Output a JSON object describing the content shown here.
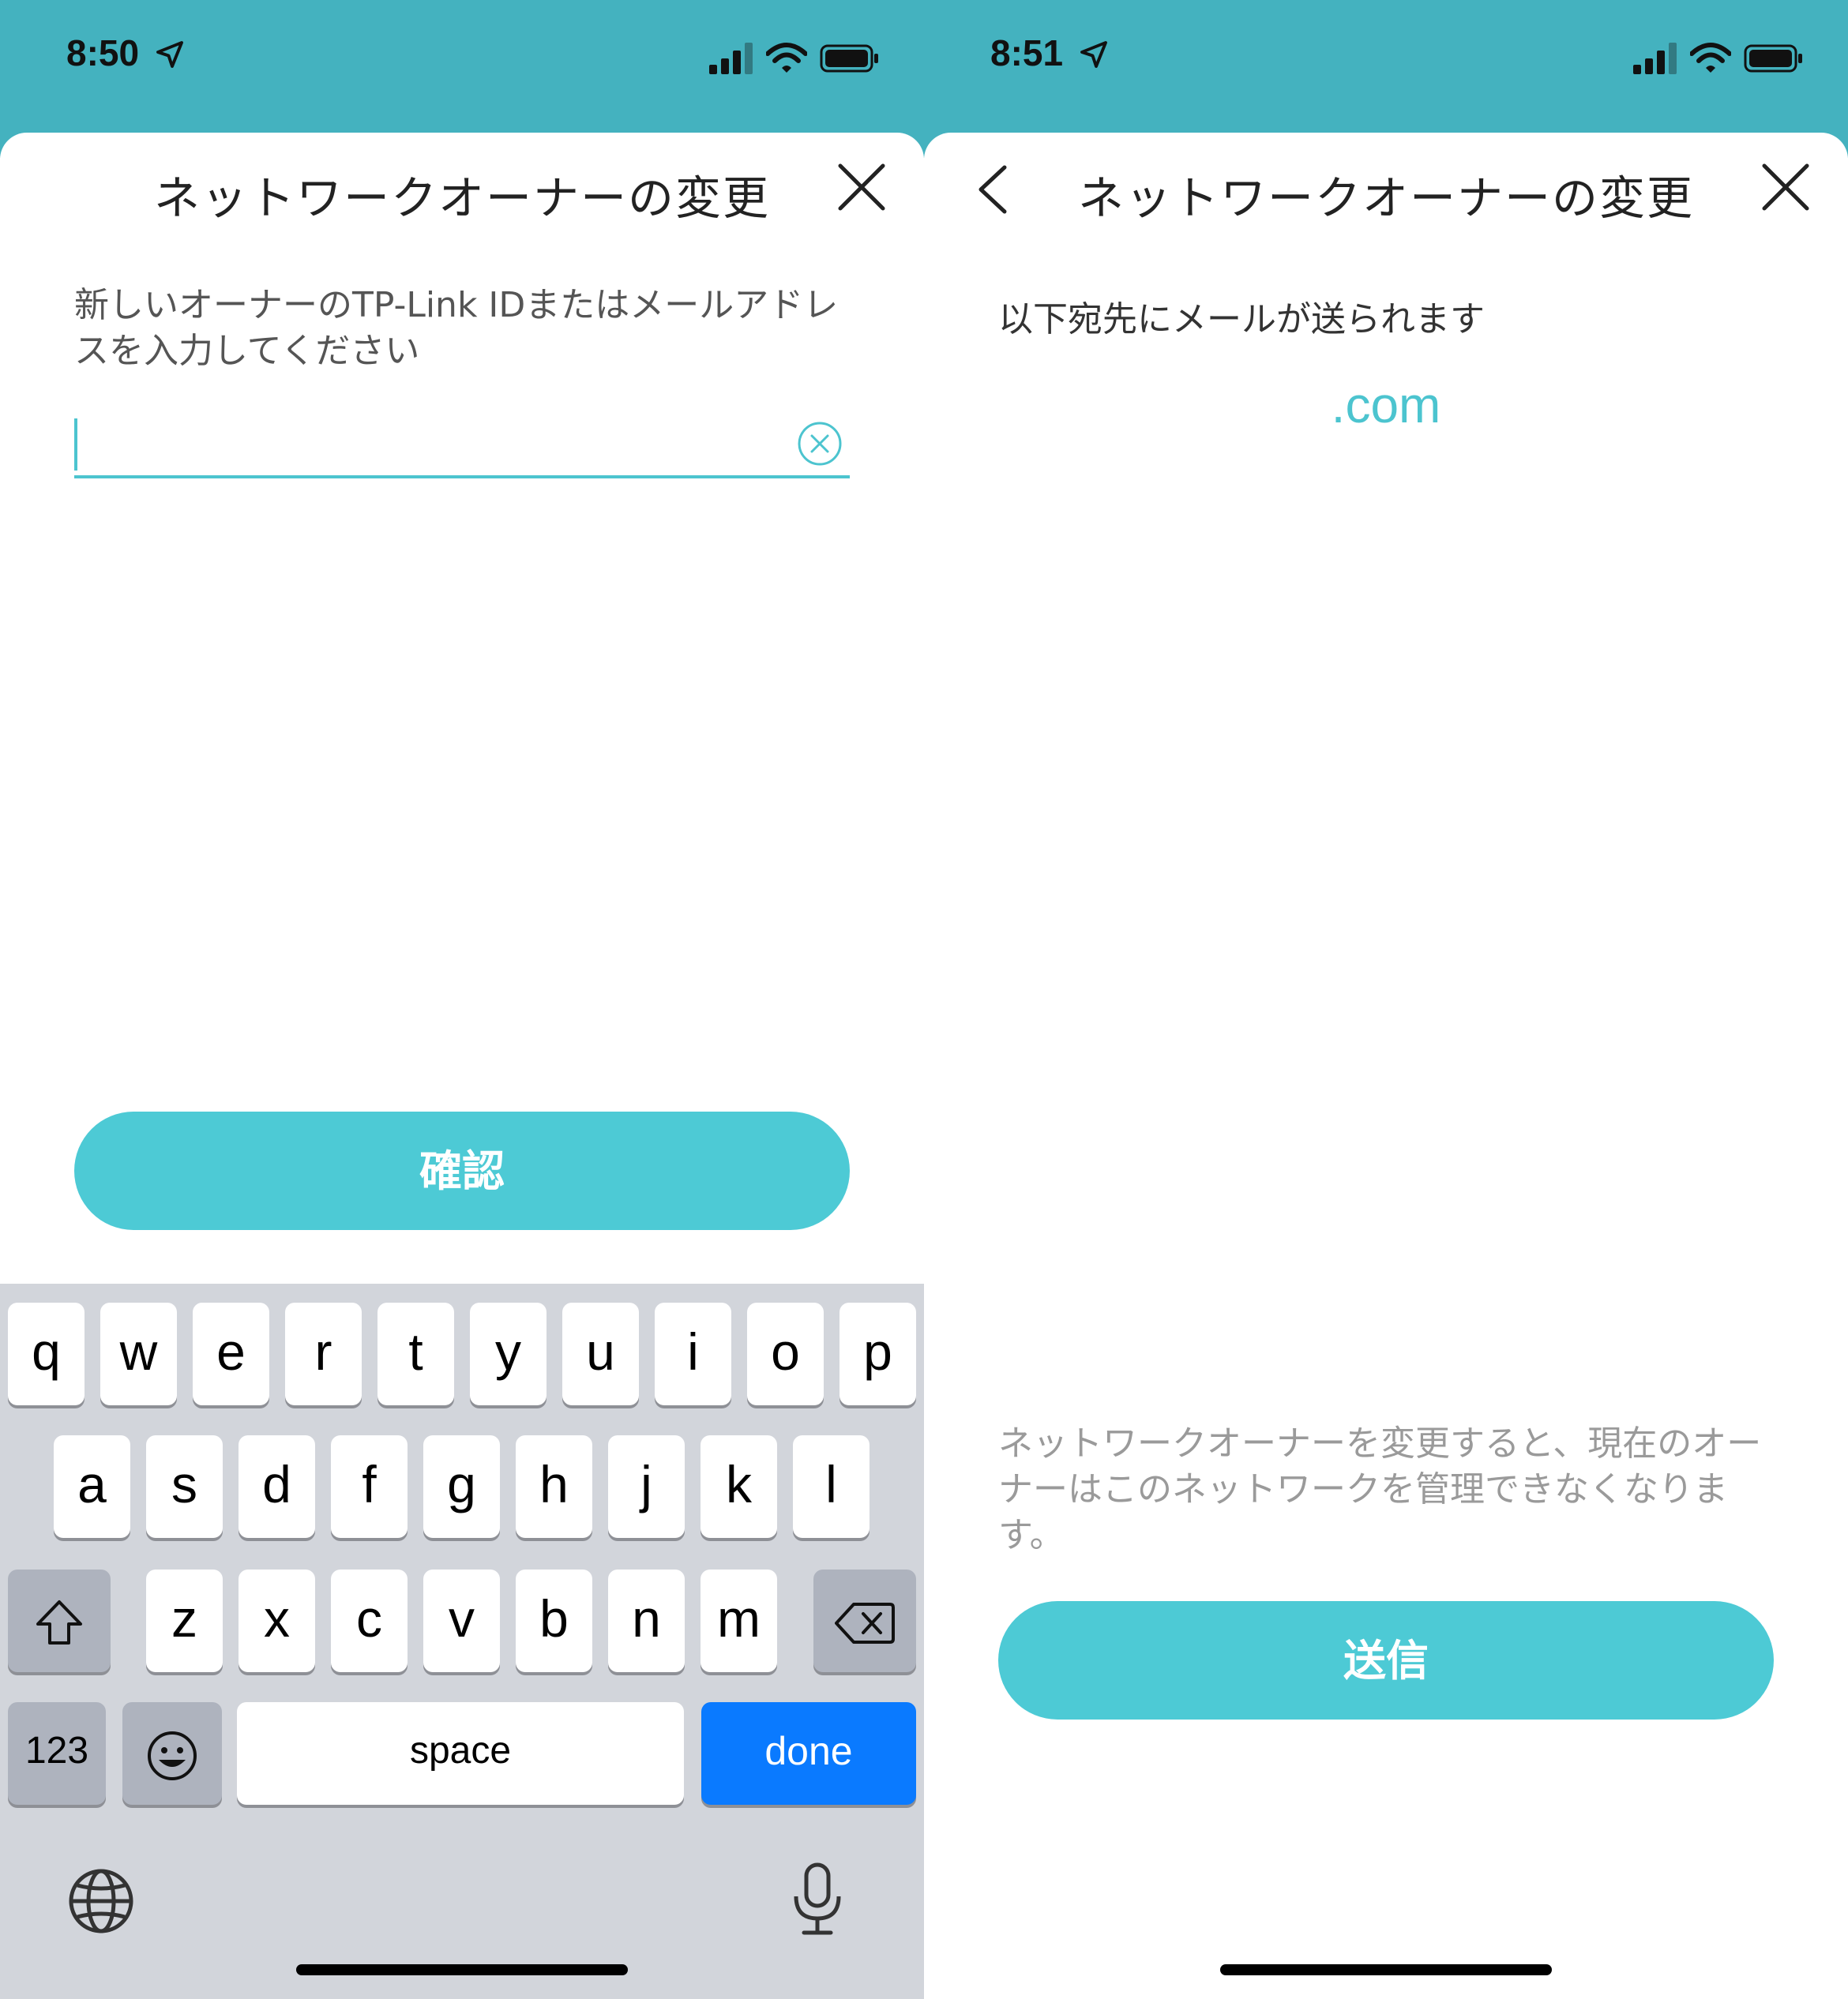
{
  "left_screen": {
    "status": {
      "time": "8:50"
    },
    "title": "ネットワークオーナーの変更",
    "prompt": "新しいオーナーのTP-Link IDまたはメールアドレスを入力してください",
    "input": {
      "value": "",
      "placeholder": ""
    },
    "confirm_button": "確認",
    "keyboard": {
      "row1": [
        "q",
        "w",
        "e",
        "r",
        "t",
        "y",
        "u",
        "i",
        "o",
        "p"
      ],
      "row2": [
        "a",
        "s",
        "d",
        "f",
        "g",
        "h",
        "j",
        "k",
        "l"
      ],
      "row3": [
        "z",
        "x",
        "c",
        "v",
        "b",
        "n",
        "m"
      ],
      "num_key": "123",
      "space_key": "space",
      "done_key": "done"
    }
  },
  "right_screen": {
    "status": {
      "time": "8:51"
    },
    "title": "ネットワークオーナーの変更",
    "info": "以下宛先にメールが送られます",
    "email": ".com",
    "note": "ネットワークオーナーを変更すると、現在のオーナーはこのネットワークを管理できなくなります。",
    "send_button": "送信"
  },
  "colors": {
    "header_teal": "#44b2bf",
    "accent": "#4dcad5",
    "keyboard_bg": "#d2d5db",
    "done_blue": "#0a7aff"
  }
}
